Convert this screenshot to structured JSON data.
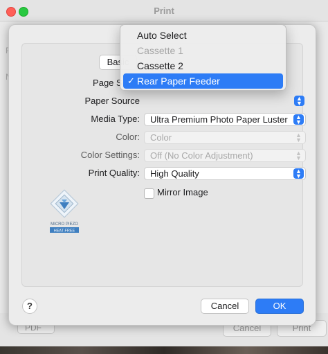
{
  "background_window": {
    "title": "Print",
    "pdf_label": "PDF",
    "cancel_label": "Cancel",
    "print_label": "Print"
  },
  "tabs": {
    "basic": "Basic"
  },
  "form": {
    "page_setup_label": "Page Setup",
    "paper_source_label": "Paper Source",
    "media_type_label": "Media Type:",
    "media_type_value": "Ultra Premium Photo Paper Luster",
    "color_label": "Color:",
    "color_value": "Color",
    "color_settings_label": "Color Settings:",
    "color_settings_value": "Off (No Color Adjustment)",
    "print_quality_label": "Print Quality:",
    "print_quality_value": "High Quality",
    "mirror_image_label": "Mirror Image",
    "mirror_image_checked": false
  },
  "logo": {
    "line1": "MICRO PIEZO",
    "line2": "HEAT-FREE"
  },
  "paper_source_menu": {
    "items": [
      {
        "label": "Auto Select",
        "state": "normal"
      },
      {
        "label": "Cassette 1",
        "state": "disabled"
      },
      {
        "label": "Cassette 2",
        "state": "normal"
      },
      {
        "label": "Rear Paper Feeder",
        "state": "selected"
      }
    ],
    "check_mark": "✓"
  },
  "buttons": {
    "help": "?",
    "cancel": "Cancel",
    "ok": "OK"
  },
  "colors": {
    "accent": "#2d7cf6"
  }
}
